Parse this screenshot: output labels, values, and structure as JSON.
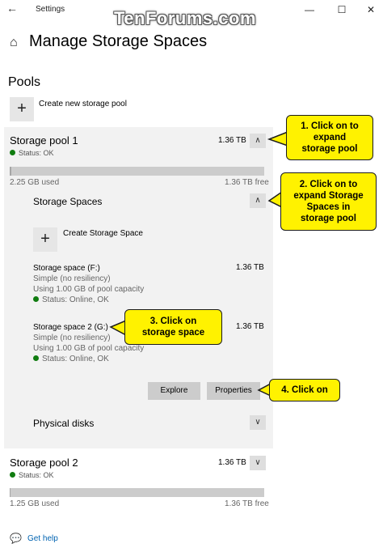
{
  "window": {
    "title": "Settings",
    "watermark": "TenForums.com",
    "back_glyph": "←",
    "min_glyph": "—",
    "max_glyph": "☐",
    "close_glyph": "✕"
  },
  "header": {
    "home_glyph": "⌂",
    "title": "Manage Storage Spaces"
  },
  "pools_section": {
    "title": "Pools",
    "create_pool_label": "Create new storage pool",
    "plus_glyph": "+"
  },
  "pool1": {
    "name": "Storage pool 1",
    "size": "1.36 TB",
    "status": "Status: OK",
    "used": "2.25 GB used",
    "free": "1.36 TB free",
    "usage_percent": 0.5,
    "chevron": "∧",
    "spaces_header": "Storage Spaces",
    "create_space_label": "Create Storage Space",
    "spaces": [
      {
        "name": "Storage space (F:)",
        "size": "1.36 TB",
        "resiliency": "Simple (no resiliency)",
        "capacity": "Using 1.00 GB of pool capacity",
        "status": "Status: Online, OK"
      },
      {
        "name": "Storage space 2 (G:)",
        "size": "1.36 TB",
        "resiliency": "Simple (no resiliency)",
        "capacity": "Using 1.00 GB of pool capacity",
        "status": "Status: Online, OK"
      }
    ],
    "explore_label": "Explore",
    "properties_label": "Properties",
    "physical_disks_label": "Physical disks",
    "physical_chevron": "∨"
  },
  "pool2": {
    "name": "Storage pool 2",
    "size": "1.36 TB",
    "status": "Status: OK",
    "used": "1.25 GB used",
    "free": "1.36 TB free",
    "usage_percent": 0.3,
    "chevron": "∨"
  },
  "footer": {
    "help_glyph": "💬",
    "help_label": "Get help"
  },
  "callouts": {
    "c1": [
      "1. Click on to",
      "expand",
      "storage pool"
    ],
    "c2": [
      "2. Click on to",
      "expand Storage",
      "Spaces in",
      "storage pool"
    ],
    "c3": [
      "3. Click on",
      "storage space"
    ],
    "c4": [
      "4. Click on"
    ]
  },
  "colors": {
    "callout_bg": "#fff200",
    "status_ok": "#107c10",
    "link": "#0063b1",
    "panel": "#f2f2f2"
  }
}
